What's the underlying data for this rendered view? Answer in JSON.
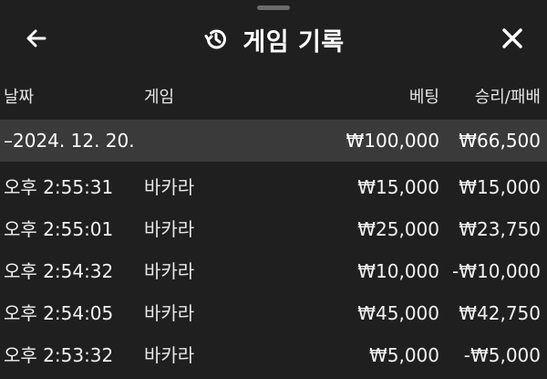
{
  "header": {
    "title": "게임 기록",
    "back_icon": "arrow-left-icon",
    "history_icon": "history-icon",
    "close_icon": "close-icon"
  },
  "columns": {
    "date": "날짜",
    "game": "게임",
    "bet": "베팅",
    "result": "승리/패배"
  },
  "group": {
    "date": "–2024. 12. 20.",
    "bet": "₩100,000",
    "result": "₩66,500"
  },
  "rows": [
    {
      "time": "오후 2:55:31",
      "game": "바카라",
      "bet": "₩15,000",
      "result": "₩15,000"
    },
    {
      "time": "오후 2:55:01",
      "game": "바카라",
      "bet": "₩25,000",
      "result": "₩23,750"
    },
    {
      "time": "오후 2:54:32",
      "game": "바카라",
      "bet": "₩10,000",
      "result": "-₩10,000"
    },
    {
      "time": "오후 2:54:05",
      "game": "바카라",
      "bet": "₩45,000",
      "result": "₩42,750"
    },
    {
      "time": "오후 2:53:32",
      "game": "바카라",
      "bet": "₩5,000",
      "result": "-₩5,000"
    }
  ]
}
